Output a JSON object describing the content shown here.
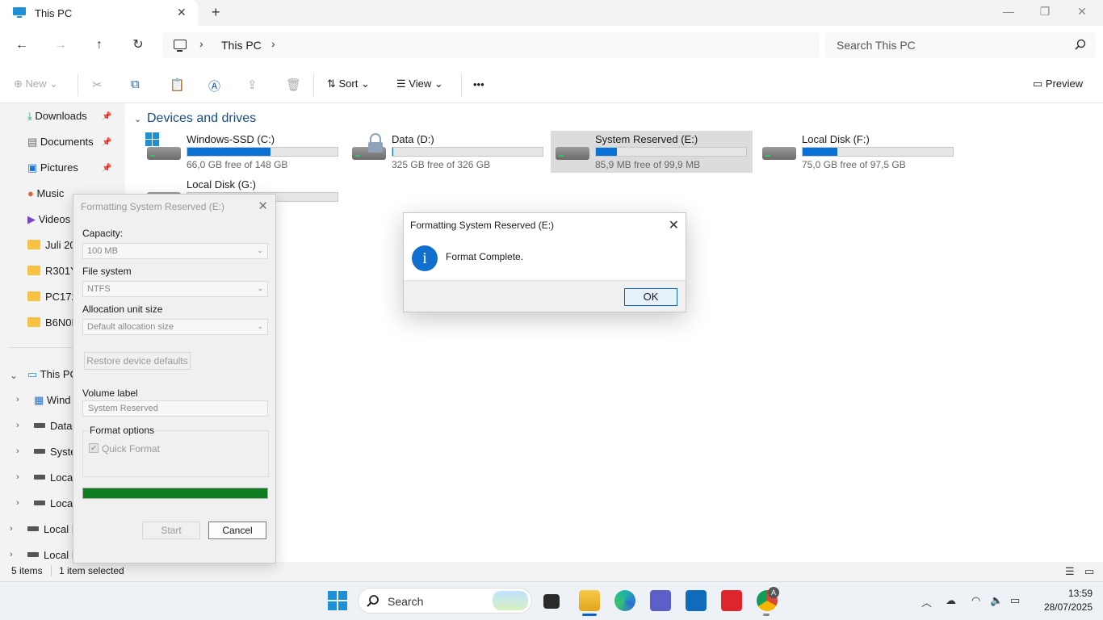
{
  "window": {
    "tab_title": "This PC",
    "new_tab": "+",
    "close_tab": "✕",
    "minimize": "—",
    "restore": "❐",
    "close": "✕"
  },
  "address": {
    "crumb": "This PC",
    "separator": "›"
  },
  "search": {
    "placeholder": "Search This PC"
  },
  "commands": {
    "new": "New",
    "sort": "Sort",
    "view": "View",
    "more": "•••",
    "preview": "Preview"
  },
  "nav": {
    "quick": [
      {
        "label": "Downloads",
        "icon": "download-icon"
      },
      {
        "label": "Documents",
        "icon": "document-icon"
      },
      {
        "label": "Pictures",
        "icon": "pictures-icon"
      },
      {
        "label": "Music",
        "icon": "music-icon"
      },
      {
        "label": "Videos",
        "icon": "videos-icon"
      },
      {
        "label": "Juli 202",
        "icon": "folder-icon"
      },
      {
        "label": "R301Y9",
        "icon": "folder-icon"
      },
      {
        "label": "PC172",
        "icon": "folder-icon"
      },
      {
        "label": "B6N0B",
        "icon": "folder-icon"
      }
    ],
    "this_pc": "This PC",
    "drives": [
      "Wind",
      "Data",
      "Syste",
      "Local",
      "Local"
    ],
    "extra": [
      "Local D",
      "Local D"
    ]
  },
  "section_title": "Devices and drives",
  "drives": [
    {
      "name": "Windows-SSD (C:)",
      "free": "66,0 GB free of 148 GB",
      "used_fraction": 0.554
    },
    {
      "name": "Data (D:)",
      "free": "325 GB free of 326 GB",
      "used_fraction": 0.003
    },
    {
      "name": "System Reserved (E:)",
      "free": "85,9 MB free of 99,9 MB",
      "used_fraction": 0.14
    },
    {
      "name": "Local Disk (F:)",
      "free": "75,0 GB free of 97,5 GB",
      "used_fraction": 0.231
    },
    {
      "name": "Local Disk (G:)",
      "free": "",
      "used_fraction": 0.0
    }
  ],
  "status": {
    "items": "5 items",
    "selected": "1 item selected"
  },
  "format_dialog": {
    "title": "Formatting System Reserved (E:)",
    "capacity_label": "Capacity:",
    "capacity_value": "100 MB",
    "fs_label": "File system",
    "fs_value": "NTFS",
    "alloc_label": "Allocation unit size",
    "alloc_value": "Default allocation size",
    "restore": "Restore device defaults",
    "volume_label": "Volume label",
    "volume_value": "System Reserved",
    "options_label": "Format options",
    "quick_format": "Quick Format",
    "progress": 1.0,
    "start": "Start",
    "cancel": "Cancel"
  },
  "message_box": {
    "title": "Formatting System Reserved (E:)",
    "text": "Format Complete.",
    "ok": "OK",
    "icon": "i"
  },
  "taskbar": {
    "search": "Search",
    "time": "13:59",
    "date": "28/07/2025",
    "chrome_badge": "A"
  }
}
